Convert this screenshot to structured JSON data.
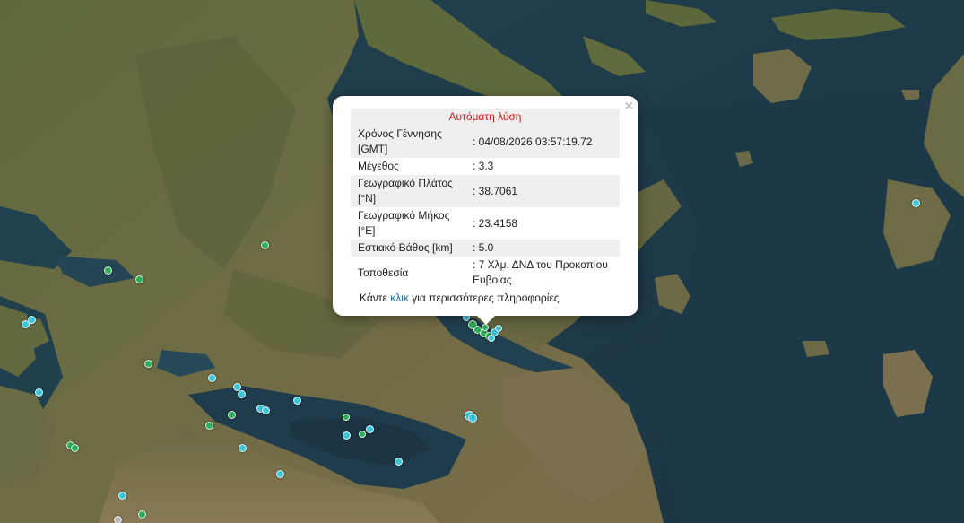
{
  "popup": {
    "title": "Αυτόματη λύση",
    "close_label": "×",
    "rows": [
      {
        "label": "Χρόνος Γέννησης [GMT]",
        "value": ": 04/08/2026 03:57:19.72"
      },
      {
        "label": "Μέγεθος",
        "value": ": 3.3"
      },
      {
        "label": "Γεωγραφικό Πλάτος [°N]",
        "value": ": 38.7061"
      },
      {
        "label": "Γεωγραφικό Μήκος [°E]",
        "value": ": 23.4158"
      },
      {
        "label": "Εστιακό Βάθος [km]",
        "value": ": 5.0"
      },
      {
        "label": "Τοποθεσία",
        "value": ": 7 Χλμ. ΔΝΔ του Προκοπίου Ευβοίας"
      }
    ],
    "footer_prefix": "Κάντε ",
    "footer_link": "κλικ",
    "footer_suffix": " για περισσότερες πληροφορίες"
  },
  "marker_colors": {
    "cyan": "#3cc6dc",
    "green": "#2fae5a",
    "gray": "#b8b8b8"
  }
}
